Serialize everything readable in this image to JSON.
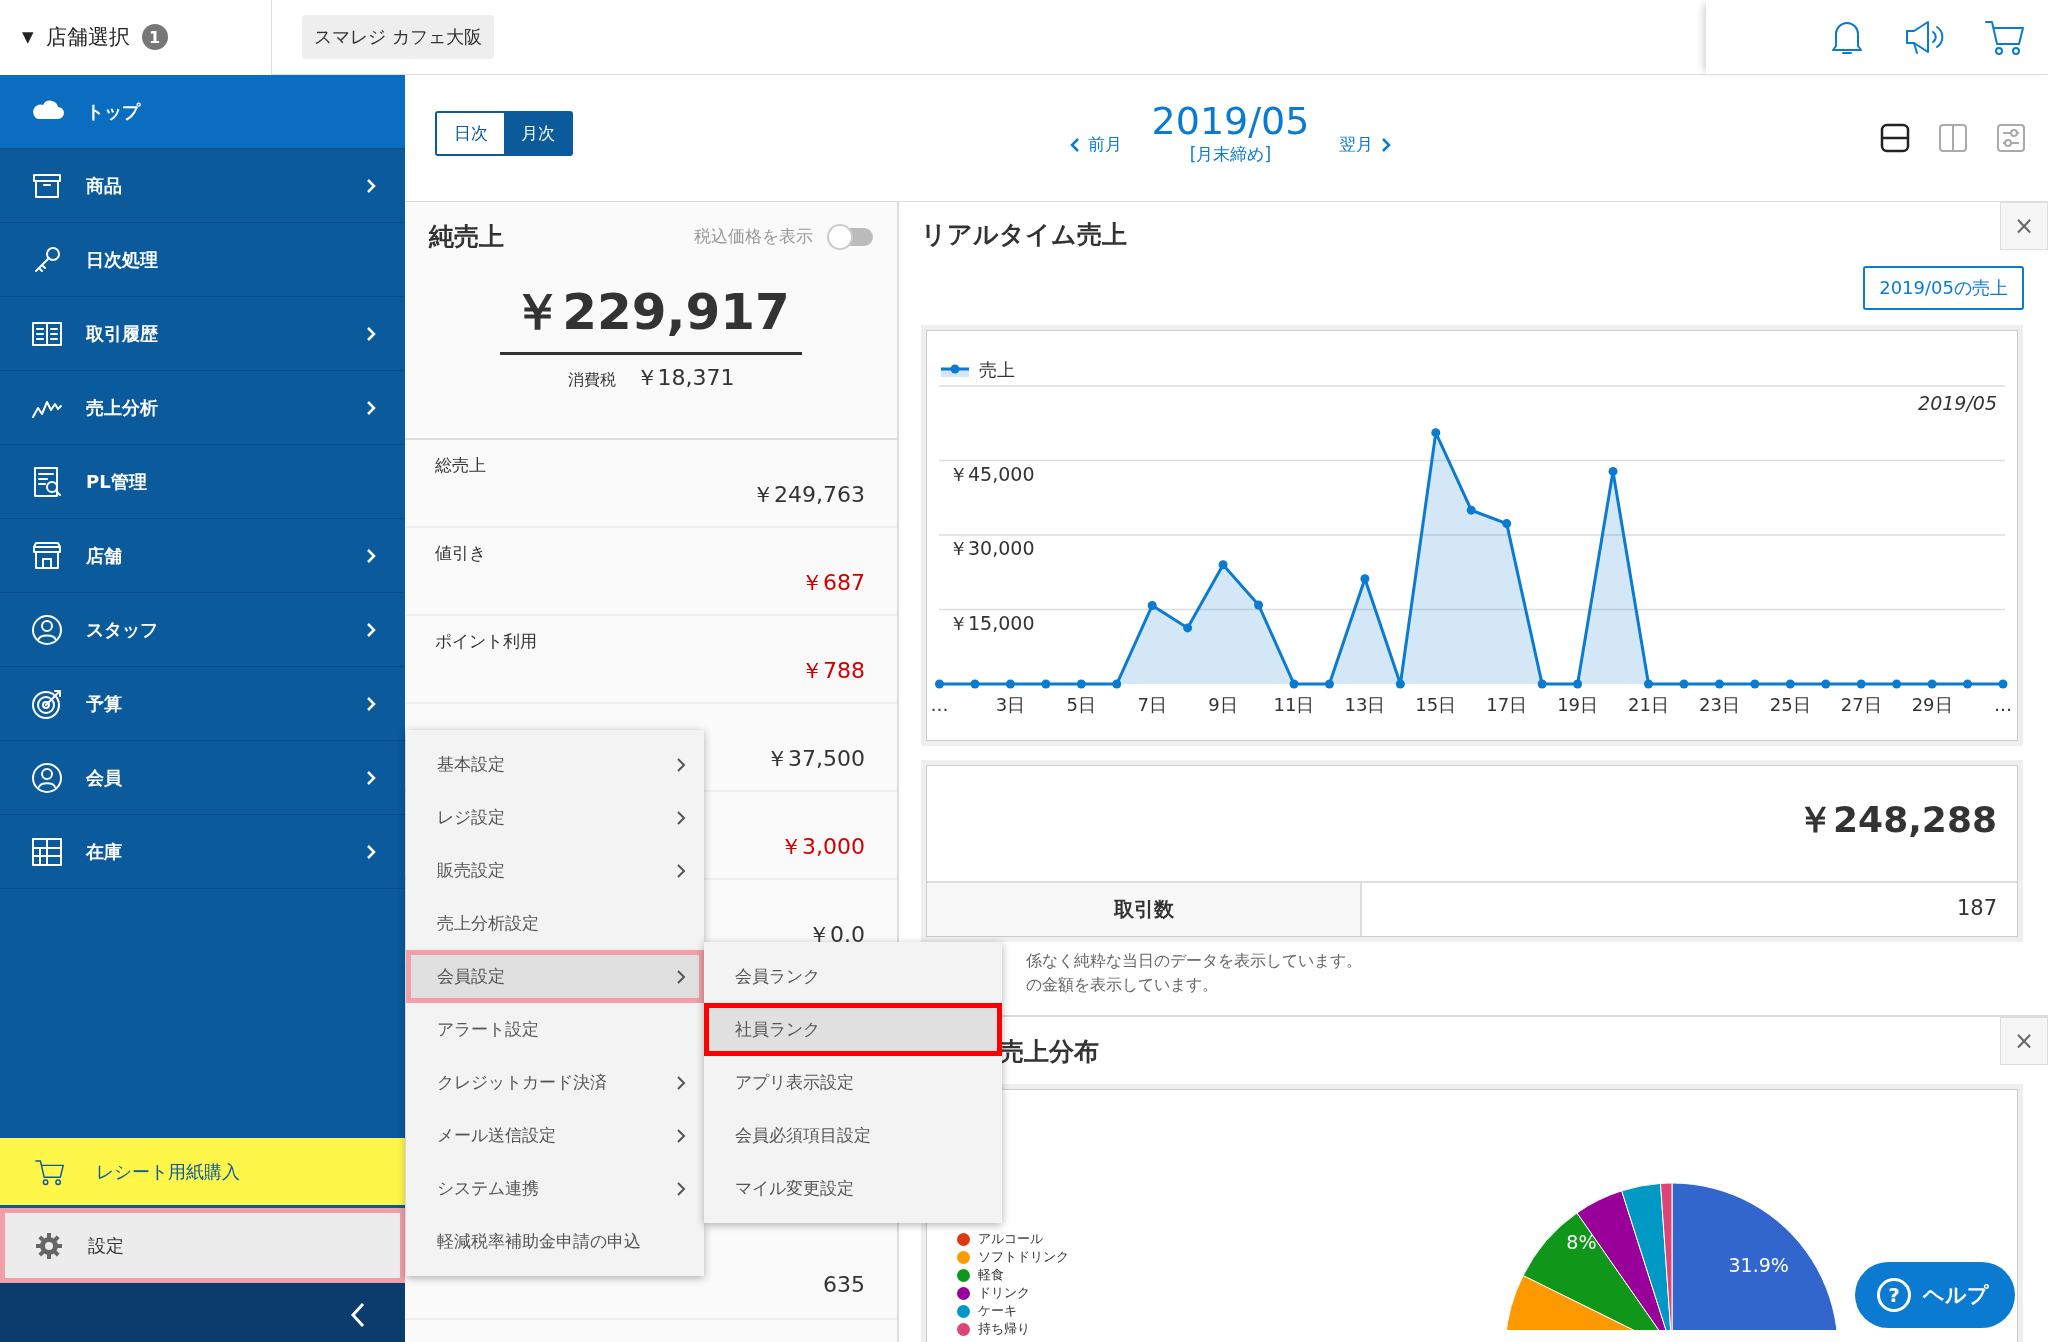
{
  "header": {
    "store_selector": {
      "caret": "▼",
      "label": "店舗選択",
      "badge": "1"
    },
    "store_name": "スマレジ カフェ大阪"
  },
  "sidebar": {
    "items": [
      {
        "kind": "cloud",
        "label": "トップ",
        "submenu": false,
        "selected": true
      },
      {
        "kind": "box",
        "label": "商品",
        "submenu": true,
        "selected": false
      },
      {
        "kind": "key",
        "label": "日次処理",
        "submenu": false,
        "selected": false
      },
      {
        "kind": "book",
        "label": "取引履歴",
        "submenu": true,
        "selected": false
      },
      {
        "kind": "trend",
        "label": "売上分析",
        "submenu": true,
        "selected": false
      },
      {
        "kind": "report",
        "label": "PL管理",
        "submenu": false,
        "selected": false
      },
      {
        "kind": "store",
        "label": "店舗",
        "submenu": true,
        "selected": false
      },
      {
        "kind": "person",
        "label": "スタッフ",
        "submenu": true,
        "selected": false
      },
      {
        "kind": "target",
        "label": "予算",
        "submenu": true,
        "selected": false
      },
      {
        "kind": "member",
        "label": "会員",
        "submenu": true,
        "selected": false
      },
      {
        "kind": "grid",
        "label": "在庫",
        "submenu": true,
        "selected": false
      }
    ],
    "bottom_items": [
      {
        "kind": "promo",
        "label": "レシート用紙購入"
      },
      {
        "kind": "settings",
        "label": "設定",
        "selected": true
      }
    ]
  },
  "toolbar": {
    "modes": [
      {
        "label": "日次",
        "selected": false
      },
      {
        "label": "月次",
        "selected": true
      }
    ],
    "prev": "前月",
    "period": "2019/05",
    "closing": "[月末締め]",
    "next": "翌月",
    "layouts": [
      {
        "kind": "rows",
        "selected": true
      },
      {
        "kind": "columns",
        "selected": false
      },
      {
        "kind": "sliders",
        "selected": false
      }
    ]
  },
  "net_sales": {
    "title": "純売上",
    "tax_toggle": {
      "label": "税込価格を表示",
      "on": false
    },
    "total": "￥229,917",
    "tax_label": "消費税",
    "tax_value": "￥18,371",
    "rows": [
      {
        "label": "総売上",
        "value": "￥249,763",
        "negative": false
      },
      {
        "label": "値引き",
        "value": "￥687",
        "negative": true
      },
      {
        "label": "ポイント利用",
        "value": "￥788",
        "negative": true
      },
      {
        "value": "￥37,500",
        "negative": false
      },
      {
        "value": "￥3,000",
        "negative": true
      },
      {
        "value": "￥0.0",
        "negative": false
      },
      {
        "value": "635",
        "negative": false
      }
    ]
  },
  "realtime": {
    "title": "リアルタイム売上",
    "close": "×",
    "period_button": "2019/05の売上",
    "chart_data": {
      "type": "area",
      "title": "2019/05",
      "x": [
        1,
        2,
        3,
        4,
        5,
        6,
        7,
        8,
        9,
        10,
        11,
        12,
        13,
        14,
        15,
        16,
        17,
        18,
        19,
        20,
        21,
        22,
        23,
        24,
        25,
        26,
        27,
        28,
        29,
        30,
        31
      ],
      "series": [
        {
          "name": "売上",
          "color": "#0b7bd1",
          "values": [
            0,
            0,
            0,
            0,
            0,
            0,
            15800,
            11300,
            24000,
            15900,
            0,
            0,
            21200,
            0,
            50600,
            35000,
            32300,
            0,
            0,
            42800,
            0,
            0,
            0,
            0,
            0,
            0,
            0,
            0,
            0,
            0,
            0
          ]
        }
      ],
      "xlim": [
        1,
        31
      ],
      "ylim": [
        0,
        60000
      ],
      "grid": true,
      "yticks": [
        {
          "value": 15000,
          "label": "￥15,000"
        },
        {
          "value": 30000,
          "label": "￥30,000"
        },
        {
          "value": 45000,
          "label": "￥45,000"
        }
      ],
      "xticks": [
        {
          "value": 1,
          "label": "…"
        },
        {
          "value": 3,
          "label": "3日"
        },
        {
          "value": 5,
          "label": "5日"
        },
        {
          "value": 7,
          "label": "7日"
        },
        {
          "value": 9,
          "label": "9日"
        },
        {
          "value": 11,
          "label": "11日"
        },
        {
          "value": 13,
          "label": "13日"
        },
        {
          "value": 15,
          "label": "15日"
        },
        {
          "value": 17,
          "label": "17日"
        },
        {
          "value": 19,
          "label": "19日"
        },
        {
          "value": 21,
          "label": "21日"
        },
        {
          "value": 23,
          "label": "23日"
        },
        {
          "value": 25,
          "label": "25日"
        },
        {
          "value": 27,
          "label": "27日"
        },
        {
          "value": 29,
          "label": "29日"
        },
        {
          "value": 31,
          "label": "…"
        }
      ]
    },
    "total": "￥248,288",
    "transactions_label": "取引数",
    "transactions_value": "187",
    "notes": [
      "係なく純粋な当日のデータを表示しています。",
      "の金額を表示しています。"
    ]
  },
  "distribution": {
    "title": "売上分布",
    "close": "×",
    "legend": [
      {
        "label": "アルコール",
        "color": "#dc3912"
      },
      {
        "label": "ソフトドリンク",
        "color": "#ff9900"
      },
      {
        "label": "軽食",
        "color": "#109618"
      },
      {
        "label": "ドリンク",
        "color": "#990099"
      },
      {
        "label": "ケーキ",
        "color": "#0099c6"
      },
      {
        "label": "持ち帰り",
        "color": "#dd4477"
      }
    ],
    "slices": [
      {
        "color": "#3366cc",
        "label": "31.9%"
      },
      {
        "color": "#ff9900"
      },
      {
        "color": "#109618",
        "label": "8%"
      },
      {
        "color": "#990099"
      },
      {
        "color": "#0099c6"
      },
      {
        "color": "#dd4477"
      }
    ]
  },
  "menu": {
    "items": [
      {
        "label": "基本設定",
        "submenu": true,
        "selected": false
      },
      {
        "label": "レジ設定",
        "submenu": true,
        "selected": false
      },
      {
        "label": "販売設定",
        "submenu": true,
        "selected": false
      },
      {
        "label": "売上分析設定",
        "submenu": false,
        "selected": false
      },
      {
        "label": "会員設定",
        "submenu": true,
        "selected": true
      },
      {
        "label": "アラート設定",
        "submenu": false,
        "selected": false
      },
      {
        "label": "クレジットカード決済",
        "submenu": true,
        "selected": false
      },
      {
        "label": "メール送信設定",
        "submenu": true,
        "selected": false
      },
      {
        "label": "システム連携",
        "submenu": true,
        "selected": false
      },
      {
        "label": "軽減税率補助金申請の申込",
        "submenu": false,
        "selected": false
      }
    ],
    "submenu": [
      {
        "label": "会員ランク",
        "selected": false
      },
      {
        "label": "社員ランク",
        "selected": true
      },
      {
        "label": "アプリ表示設定",
        "selected": false
      },
      {
        "label": "会員必須項目設定",
        "selected": false
      },
      {
        "label": "マイル変更設定",
        "selected": false
      }
    ]
  },
  "help": {
    "icon": "?",
    "label": "ヘルプ"
  }
}
